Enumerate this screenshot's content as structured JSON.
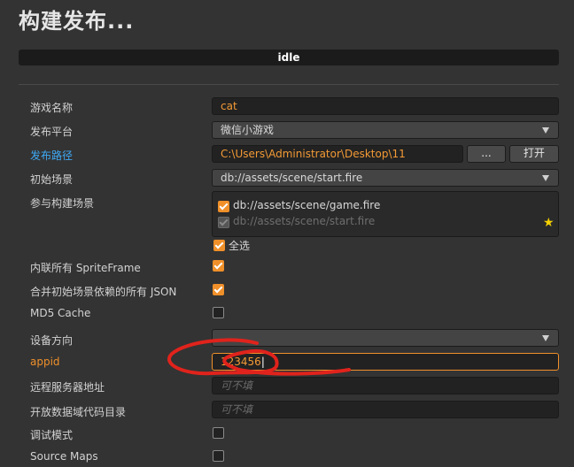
{
  "window": {
    "title": "构建发布..."
  },
  "status": {
    "text": "idle"
  },
  "form": {
    "game_name": {
      "label": "游戏名称",
      "value": "cat"
    },
    "platform": {
      "label": "发布平台",
      "value": "微信小游戏"
    },
    "build_path": {
      "label": "发布路径",
      "value": "C:\\Users\\Administrator\\Desktop\\11",
      "browse_label": "...",
      "open_label": "打开"
    },
    "start_scene": {
      "label": "初始场景",
      "value": "db://assets/scene/start.fire"
    },
    "included_scenes": {
      "label": "参与构建场景",
      "items": [
        {
          "name": "db://assets/scene/game.fire",
          "checked": true,
          "disabled": false
        },
        {
          "name": "db://assets/scene/start.fire",
          "checked": true,
          "disabled": true,
          "start_scene": true
        }
      ],
      "select_all_label": "全选",
      "select_all_checked": true
    },
    "inline_spriteframes": {
      "label": "内联所有 SpriteFrame",
      "checked": true
    },
    "merge_start_json": {
      "label": "合并初始场景依赖的所有 JSON",
      "checked": true
    },
    "md5_cache": {
      "label": "MD5 Cache",
      "checked": false
    },
    "orientation": {
      "label": "设备方向",
      "value": ""
    },
    "appid": {
      "label": "appid",
      "value": "123456"
    },
    "remote_server": {
      "label": "远程服务器地址",
      "placeholder": "可不填"
    },
    "open_data_dir": {
      "label": "开放数据域代码目录",
      "placeholder": "可不填"
    },
    "debug_mode": {
      "label": "调试模式",
      "checked": false
    },
    "source_maps": {
      "label": "Source Maps",
      "checked": false
    }
  },
  "icons": {
    "start_scene_marker": "star-icon",
    "dropdown": "chevron-down-icon"
  },
  "colors": {
    "accent": "#f0902a",
    "link": "#3fa9f5",
    "annotation": "#e0231c"
  }
}
